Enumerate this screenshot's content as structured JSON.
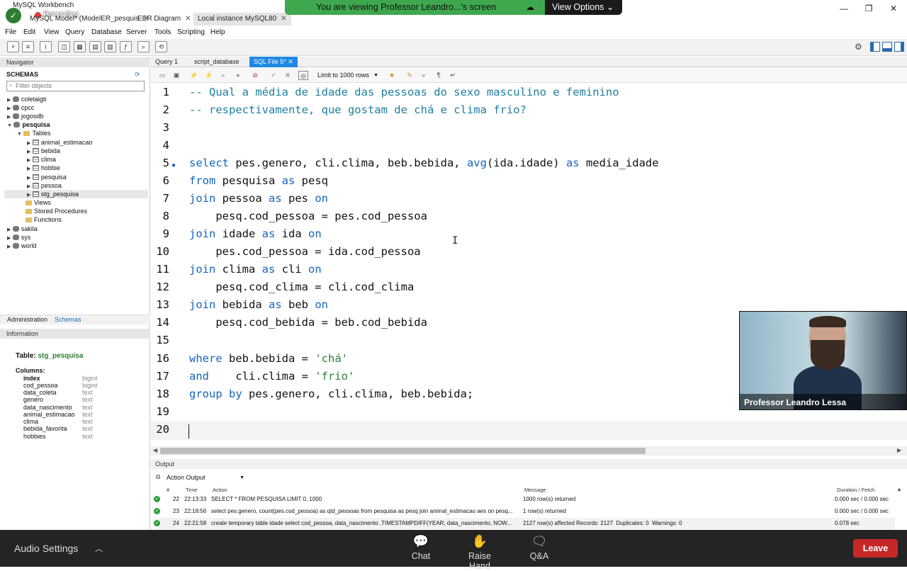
{
  "window": {
    "app_title": "MySQL Workbench",
    "tabs": [
      "MySQL Model* (ModelER_pesquis",
      "EER Diagram",
      "Local instance MySQL80"
    ],
    "recording": "Recording"
  },
  "share_banner": {
    "message": "You are viewing Professor Leandro...'s screen",
    "view_options": "View Options"
  },
  "menu": [
    "File",
    "Edit",
    "View",
    "Query",
    "Database",
    "Server",
    "Tools",
    "Scripting",
    "Help"
  ],
  "navigator": {
    "header": "Navigator",
    "schemas_label": "SCHEMAS",
    "filter_placeholder": "Filter objects",
    "schemas": [
      "coletaigti",
      "cpcc",
      "jogosdb"
    ],
    "open_schema": "pesquisa",
    "tables_label": "Tables",
    "tables": [
      "animal_estimacao",
      "bebida",
      "clima",
      "hobbie",
      "pesquisa",
      "pessoa",
      "stg_pesquisa"
    ],
    "views": "Views",
    "stored_procedures": "Stored Procedures",
    "functions": "Functions",
    "other_schemas": [
      "sakila",
      "sys",
      "world"
    ],
    "bottom_tabs": [
      "Administration",
      "Schemas"
    ]
  },
  "information": {
    "header": "Information",
    "table_prefix": "Table: ",
    "table_name": "stg_pesquisa",
    "columns_label": "Columns:",
    "columns": [
      {
        "name": "index",
        "type": "bigint"
      },
      {
        "name": "cod_pessoa",
        "type": "bigint"
      },
      {
        "name": "data_coleta",
        "type": "text"
      },
      {
        "name": "genero",
        "type": "text"
      },
      {
        "name": "data_nascimento",
        "type": "text"
      },
      {
        "name": "animal_estimacao",
        "type": "text"
      },
      {
        "name": "clima",
        "type": "text"
      },
      {
        "name": "bebida_favorita",
        "type": "text"
      },
      {
        "name": "hobbies",
        "type": "text"
      }
    ]
  },
  "editor": {
    "tabs": [
      "Query 1",
      "script_database",
      "SQL File 5*"
    ],
    "limit": "Limit to 1000 rows",
    "lines": {
      "l1": "-- Qual a média de idade das pessoas do sexo masculino e feminino",
      "l2": "-- respectivamente, que gostam de chá e clima frio?",
      "l5a": "select",
      "l5b": " pes.genero, cli.clima, beb.bebida, ",
      "l5c": "avg",
      "l5d": "(ida.idade) ",
      "l5e": "as",
      "l5f": " media_idade",
      "l6a": "from",
      "l6b": " pesquisa ",
      "l6c": "as",
      "l6d": " pesq",
      "l7a": "join",
      "l7b": " pessoa ",
      "l7c": "as",
      "l7d": " pes ",
      "l7e": "on",
      "l8": "    pesq.cod_pessoa = pes.cod_pessoa",
      "l9a": "join",
      "l9b": " idade ",
      "l9c": "as",
      "l9d": " ida ",
      "l9e": "on",
      "l10": "    pes.cod_pessoa = ida.cod_pessoa",
      "l11a": "join",
      "l11b": " clima ",
      "l11c": "as",
      "l11d": " cli ",
      "l11e": "on",
      "l12": "    pesq.cod_clima = cli.cod_clima",
      "l13a": "join",
      "l13b": " bebida ",
      "l13c": "as",
      "l13d": " beb ",
      "l13e": "on",
      "l14": "    pesq.cod_bebida = beb.cod_bebida",
      "l16a": "where",
      "l16b": " beb.bebida = ",
      "l16c": "'chá'",
      "l17a": "and",
      "l17b": "    cli.clima = ",
      "l17c": "'frio'",
      "l18a": "group by",
      "l18b": " pes.genero, cli.clima, beb.bebida;"
    }
  },
  "output": {
    "header": "Output",
    "selector": "Action Output",
    "columns": [
      "#",
      "Time",
      "Action",
      "Message",
      "Duration / Fetch"
    ],
    "rows": [
      {
        "n": "22",
        "time": "22:13:33",
        "action": "SELECT * FROM PESQUISA LIMIT 0, 1000",
        "message": "1000 row(s) returned",
        "duration": "0.000 sec / 0.000 sec"
      },
      {
        "n": "23",
        "time": "22:18:56",
        "action": "select pes.genero, count(pes.cod_pessoa) as qtd_pessoas from pesquisa as pesq join animal_estimacao aes on pesq...",
        "message": "1 row(s) returned",
        "duration": "0.000 sec / 0.000 sec"
      },
      {
        "n": "24",
        "time": "22:21:58",
        "action": "create temporary table idade select cod_pessoa, data_nascimento ,TIMESTAMPDIFF(YEAR, data_nascimento, NOW...",
        "message": "2127 row(s) affected Records: 2127  Duplicates: 0  Warnings: 0",
        "duration": "0.078 sec"
      }
    ]
  },
  "webcam": {
    "name": "Professor Leandro Lessa"
  },
  "meeting_bar": {
    "audio_settings": "Audio Settings",
    "chat": "Chat",
    "raise_hand": "Raise Hand",
    "qa": "Q&A",
    "leave": "Leave"
  }
}
